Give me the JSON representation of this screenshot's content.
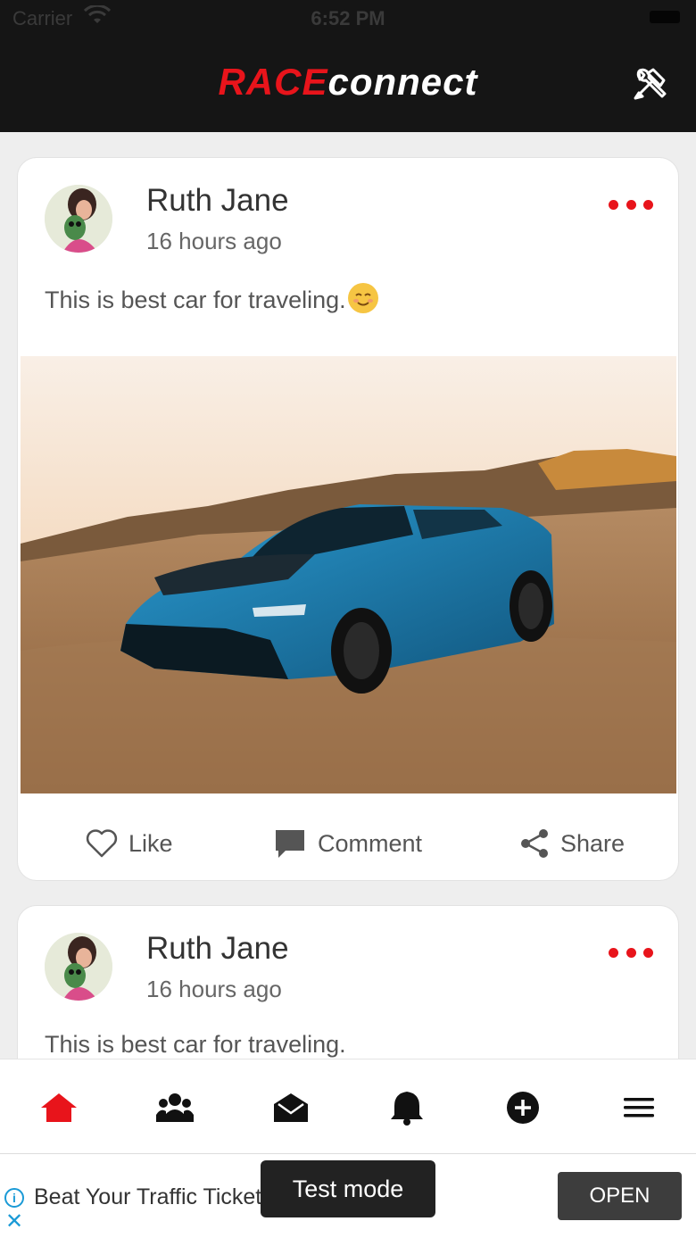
{
  "status_bar": {
    "carrier": "Carrier",
    "time": "6:52 PM"
  },
  "header": {
    "logo_race": "RACE",
    "logo_connect": "connect",
    "tools_icon": "tools-icon"
  },
  "posts": [
    {
      "author": "Ruth Jane",
      "time": "16 hours ago",
      "text": "This is best car for traveling.",
      "emoji": "smiling-face",
      "has_image": true,
      "actions": {
        "like": "Like",
        "comment": "Comment",
        "share": "Share"
      }
    },
    {
      "author": "Ruth Jane",
      "time": "16 hours ago",
      "text": "This is best car for traveling."
    }
  ],
  "bottom_nav": [
    "home-icon",
    "friends-icon",
    "messages-icon",
    "notifications-icon",
    "add-icon",
    "menu-icon"
  ],
  "colors": {
    "accent": "#e8141b",
    "header_bg": "#151515",
    "active_nav": "#e8141b"
  },
  "ad": {
    "text": "Beat Your Traffic Ticket",
    "button": "OPEN",
    "info_icon": "info-icon",
    "close_icon": "close-icon"
  },
  "toast": {
    "text": "Test mode"
  }
}
